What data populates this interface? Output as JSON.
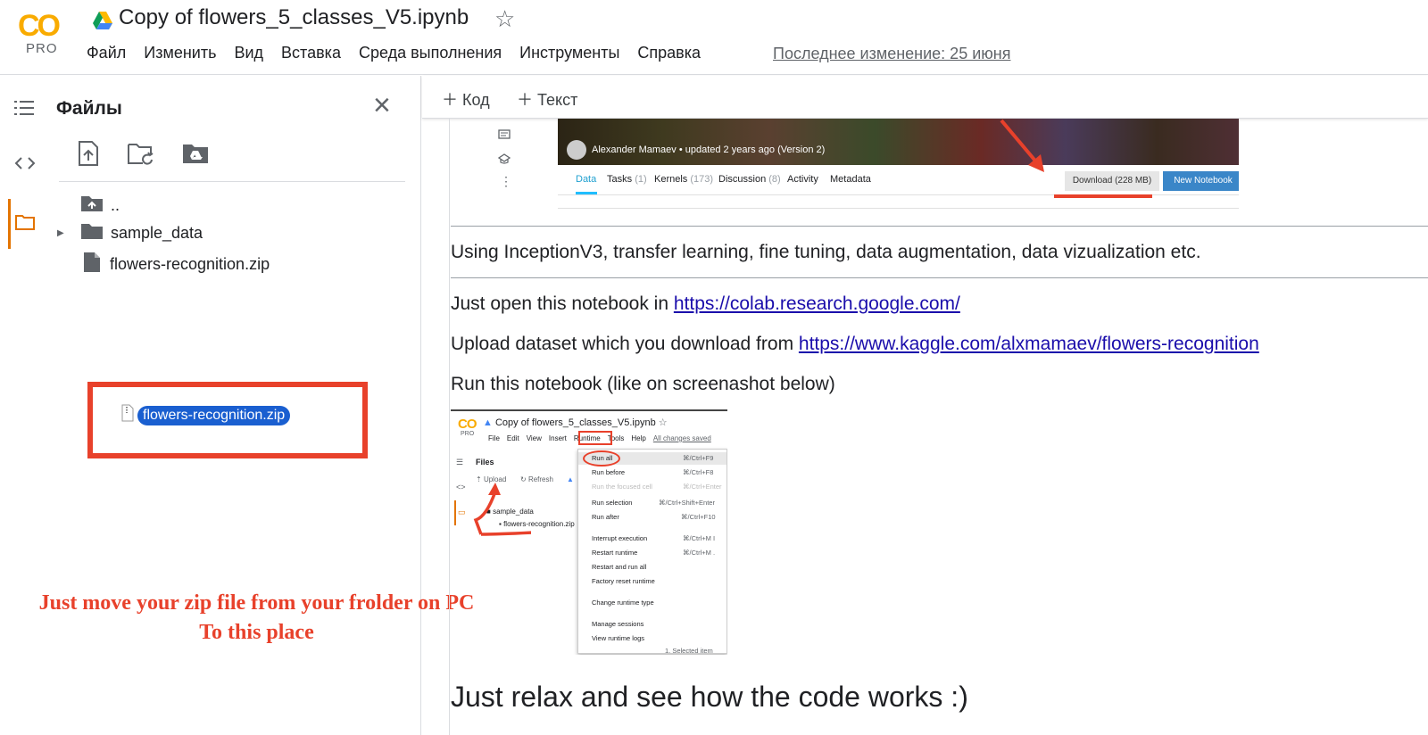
{
  "header": {
    "logo_co": "CO",
    "logo_pro": "PRO",
    "title": "Copy of flowers_5_classes_V5.ipynb",
    "menu": [
      "Файл",
      "Изменить",
      "Вид",
      "Вставка",
      "Среда выполнения",
      "Инструменты",
      "Справка"
    ],
    "last_edit": "Последнее изменение: 25 июня"
  },
  "files_panel": {
    "title": "Файлы",
    "tree": {
      "parent": "..",
      "folder": "sample_data",
      "file": "flowers-recognition.zip"
    },
    "drag_chip": "flowers-recognition.zip",
    "instruction_line1": "Just move your zip file from your frolder on PC",
    "instruction_line2": "To this place"
  },
  "toolbar": {
    "add_code": "Код",
    "add_text": "Текст"
  },
  "kaggle": {
    "author": "Alexander Mamaev  •  updated 2 years ago (Version 2)",
    "tabs": [
      {
        "label": "Data",
        "count": ""
      },
      {
        "label": "Tasks",
        "count": "(1)"
      },
      {
        "label": "Kernels",
        "count": "(173)"
      },
      {
        "label": "Discussion",
        "count": "(8)"
      },
      {
        "label": "Activity",
        "count": ""
      },
      {
        "label": "Metadata",
        "count": ""
      }
    ],
    "download": "Download (228 MB)",
    "new_notebook": "New Notebook"
  },
  "cells": {
    "intro": "Using InceptionV3, transfer learning, fine tuning, data augmentation, data vizualization etc.",
    "open_prefix": "Just open this notebook in ",
    "open_link": "https://colab.research.google.com/",
    "upload_prefix": "Upload dataset which you download from ",
    "upload_link": "https://www.kaggle.com/alxmamaev/flowers-recognition",
    "run_text": "Run this notebook (like on screenashot below)",
    "final": "Just relax and see how the code works :)"
  },
  "mini_screenshot": {
    "title": "Copy of flowers_5_classes_V5.ipynb",
    "menu": [
      "File",
      "Edit",
      "View",
      "Insert",
      "Runtime",
      "Tools",
      "Help"
    ],
    "changes": "All changes saved",
    "files_label": "Files",
    "upload": "Upload",
    "refresh": "Refresh",
    "folder": "sample_data",
    "file": "flowers-recognition.zip",
    "dropdown": [
      {
        "label": "Run all",
        "shortcut": "⌘/Ctrl+F9"
      },
      {
        "label": "Run before",
        "shortcut": "⌘/Ctrl+F8"
      },
      {
        "label": "Run the focused cell",
        "shortcut": "⌘/Ctrl+Enter"
      },
      {
        "label": "Run selection",
        "shortcut": "⌘/Ctrl+Shift+Enter"
      },
      {
        "label": "Run after",
        "shortcut": "⌘/Ctrl+F10"
      },
      {
        "label": "Interrupt execution",
        "shortcut": "⌘/Ctrl+M I"
      },
      {
        "label": "Restart runtime",
        "shortcut": "⌘/Ctrl+M ."
      },
      {
        "label": "Restart and run all",
        "shortcut": ""
      },
      {
        "label": "Factory reset runtime",
        "shortcut": ""
      },
      {
        "label": "Change runtime type",
        "shortcut": ""
      },
      {
        "label": "Manage sessions",
        "shortcut": ""
      },
      {
        "label": "View runtime logs",
        "shortcut": ""
      }
    ],
    "footer": "1. Selected item"
  },
  "colors": {
    "accent_orange": "#f9ab00",
    "annotation_red": "#e8412b",
    "link_blue": "#1a0dab",
    "kaggle_blue": "#3a86c8"
  }
}
